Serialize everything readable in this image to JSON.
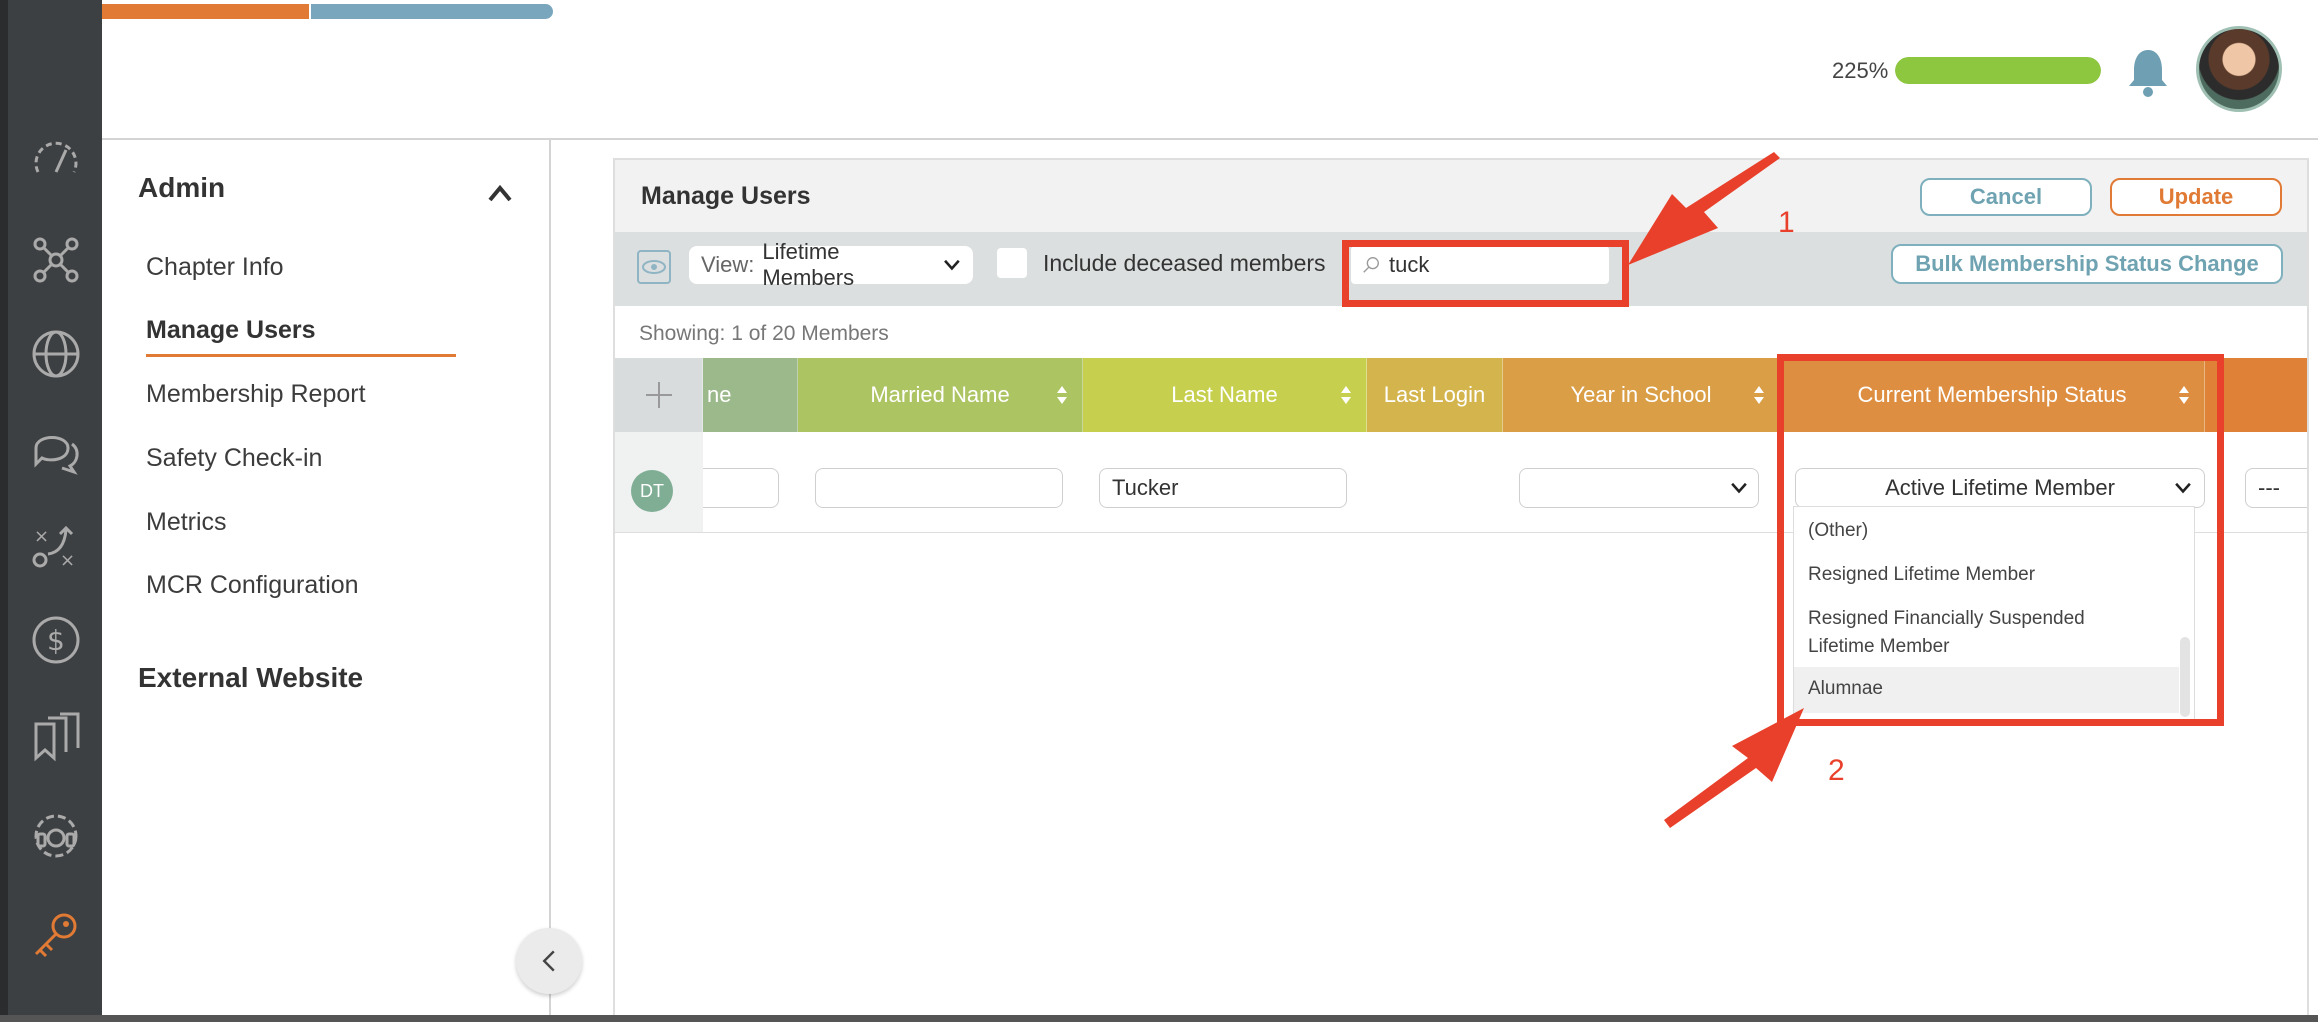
{
  "top": {
    "progress_label": "225%",
    "progress_fraction": 1.0
  },
  "menu": {
    "section_title": "Admin",
    "items": [
      "Chapter Info",
      "Manage Users",
      "Membership Report",
      "Safety Check-in",
      "Metrics",
      "MCR Configuration"
    ],
    "active": "Manage Users",
    "external_title": "External Website"
  },
  "panel": {
    "title": "Manage Users",
    "cancel_label": "Cancel",
    "update_label": "Update",
    "view_prefix": "View:",
    "view_value": "Lifetime Members",
    "include_deceased_label": "Include deceased members",
    "search_value": "tuck",
    "bulk_label": "Bulk Membership Status Change",
    "showing": "Showing: 1 of 20 Members"
  },
  "table": {
    "columns": [
      {
        "label": "ne",
        "color": "#9cb98b"
      },
      {
        "label": "Married Name",
        "color": "#adc463"
      },
      {
        "label": "Last Name",
        "color": "#c7d04e"
      },
      {
        "label": "Last Login",
        "color": "#d3b44d"
      },
      {
        "label": "Year in School",
        "color": "#d99e46"
      },
      {
        "label": "Current Membership Status",
        "color": "#de8e40"
      },
      {
        "label": "",
        "color": "#df8238"
      }
    ],
    "row": {
      "initials": "DT",
      "last_name": "Tucker",
      "status": "Active Lifetime Member",
      "extra": "---"
    }
  },
  "dropdown": {
    "options": [
      "(Other)",
      "Resigned Lifetime Member",
      "Resigned Financially Suspended Lifetime Member",
      "Alumnae"
    ]
  },
  "annotations": {
    "label_1": "1",
    "label_2": "2",
    "color": "#e8402a"
  }
}
